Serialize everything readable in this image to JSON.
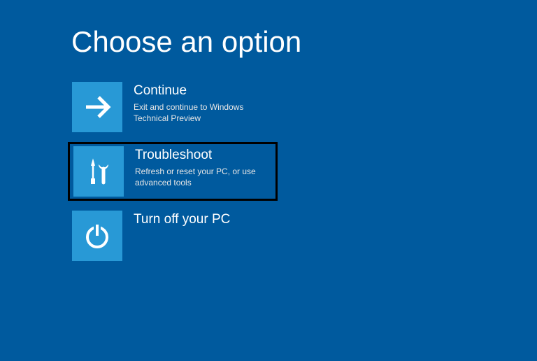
{
  "title": "Choose an option",
  "options": {
    "continue": {
      "title": "Continue",
      "desc": "Exit and continue to Windows Technical Preview"
    },
    "troubleshoot": {
      "title": "Troubleshoot",
      "desc": "Refresh or reset your PC, or use advanced tools"
    },
    "turnoff": {
      "title": "Turn off your PC",
      "desc": ""
    }
  }
}
